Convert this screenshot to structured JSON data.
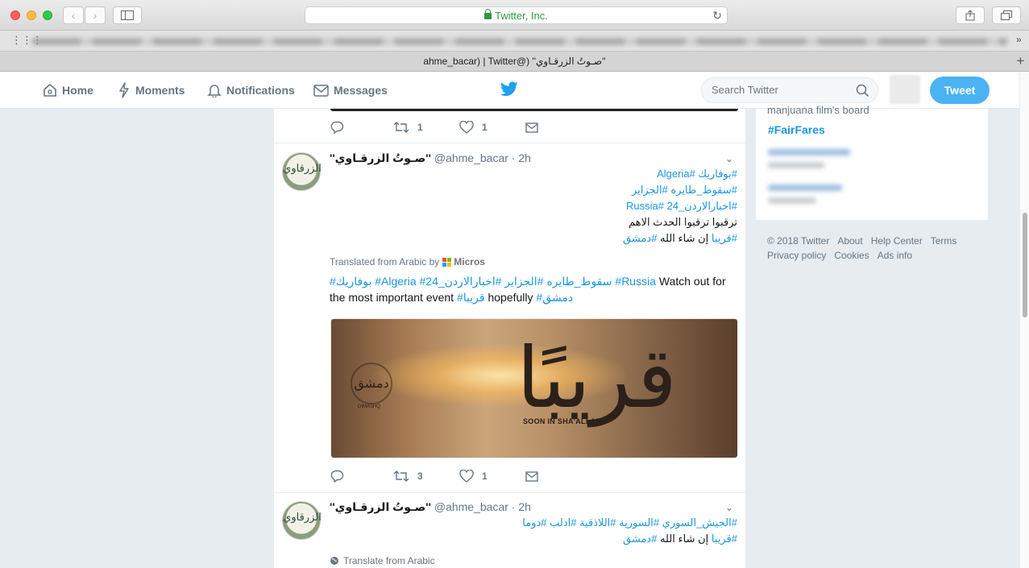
{
  "browser": {
    "address": "Twitter, Inc.",
    "tab_title": "ahme_bacar) | Twitter@) ''صـوتُ الزرقـاوي''"
  },
  "nav": {
    "home": "Home",
    "moments": "Moments",
    "notifications": "Notifications",
    "messages": "Messages",
    "search_placeholder": "Search Twitter",
    "tweet_button": "Tweet"
  },
  "prev_tweet": {
    "retweets": "1",
    "likes": "1"
  },
  "tweets": [
    {
      "name": "''صـوتُ الزرقـاوي''",
      "handle": "@ahme_bacar · 2h",
      "lines": [
        {
          "hashtags": "#بوفاريك #Algeria",
          "plain": ""
        },
        {
          "hashtags": "#سقوط_طايره #الجزاير",
          "plain": ""
        },
        {
          "hashtags": "#اخبارالاردن_24 #Russia",
          "plain": ""
        },
        {
          "hashtags": "",
          "plain": "ترقبوا ترقبوا الحدث الاهم"
        },
        {
          "hashtags": "#قريبا",
          "plain": " إن شاء الله ",
          "hashtags2": "#دمشق"
        }
      ],
      "translated_label": "Translated from Arabic by",
      "translated_by": "Micros",
      "translation": {
        "tags1": "#بوفاريك #Algeria #سقوط_طايره #الجزاير #اخبارالاردن_24 #Russia",
        "text1": " Watch out for the most important event ",
        "tag2": "#قريبا",
        "text2": " hopefully ",
        "tag3": "#دمشق"
      },
      "media": {
        "calligraphy": "قريبًا",
        "caption": "SOON IN SHA'ALLAH",
        "seal": "دمشق",
        "seal_caption": "DIMASHQ"
      },
      "retweets": "3",
      "likes": "1"
    },
    {
      "name": "''صـوتُ الزرقـاوي''",
      "handle": "@ahme_bacar · 2h",
      "line1": "#الجيش_السوري #السورية #اللاذقية #ادلب #دوما",
      "line2_tag": "#قريبا",
      "line2_plain": " إن شاء الله ",
      "line2_tag2": "#دمشق",
      "translate": "Translate from Arabic"
    }
  ],
  "avatar_text": "الزرقاوي",
  "sidebar": {
    "clipped": "manjuana film's board",
    "trend": "#FairFares"
  },
  "footer": {
    "items": [
      "© 2018 Twitter",
      "About",
      "Help Center",
      "Terms",
      "Privacy policy",
      "Cookies",
      "Ads info"
    ]
  },
  "colors": {
    "twitter_blue": "#1da1f2",
    "link": "#1b95e0",
    "tweet_button": "#4ab3f4"
  }
}
